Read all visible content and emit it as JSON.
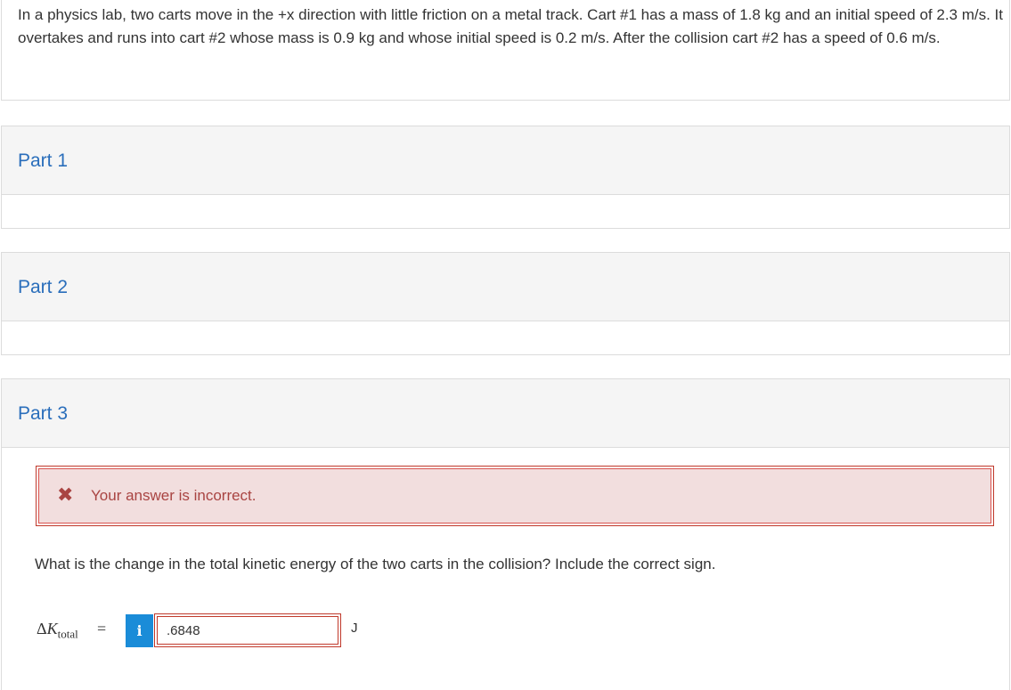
{
  "question": {
    "text": "In a physics lab, two carts move in the +x direction with little friction on a metal track. Cart #1 has a mass of 1.8 kg and an initial speed of 2.3 m/s. It overtakes and runs into cart #2 whose mass is 0.9 kg and whose initial speed is 0.2 m/s. After the collision cart #2 has a speed of 0.6 m/s."
  },
  "parts": [
    {
      "title": "Part 1"
    },
    {
      "title": "Part 2"
    },
    {
      "title": "Part 3"
    }
  ],
  "part3": {
    "feedback": {
      "icon": "x-icon",
      "glyph": "✖",
      "message": "Your answer is incorrect."
    },
    "prompt": "What is the change in the total kinetic energy of the two carts in the collision? Include the correct sign.",
    "answer": {
      "label_delta": "Δ",
      "label_var": "K",
      "label_sub": "total",
      "equals": "=",
      "info_glyph": "i",
      "value": ".6848",
      "unit": "J"
    }
  },
  "colors": {
    "part_title": "#2a6ebb",
    "error_bg": "#f2dede",
    "error_border": "#c0392b",
    "error_text": "#a94442",
    "info_badge": "#1a8cd8"
  }
}
